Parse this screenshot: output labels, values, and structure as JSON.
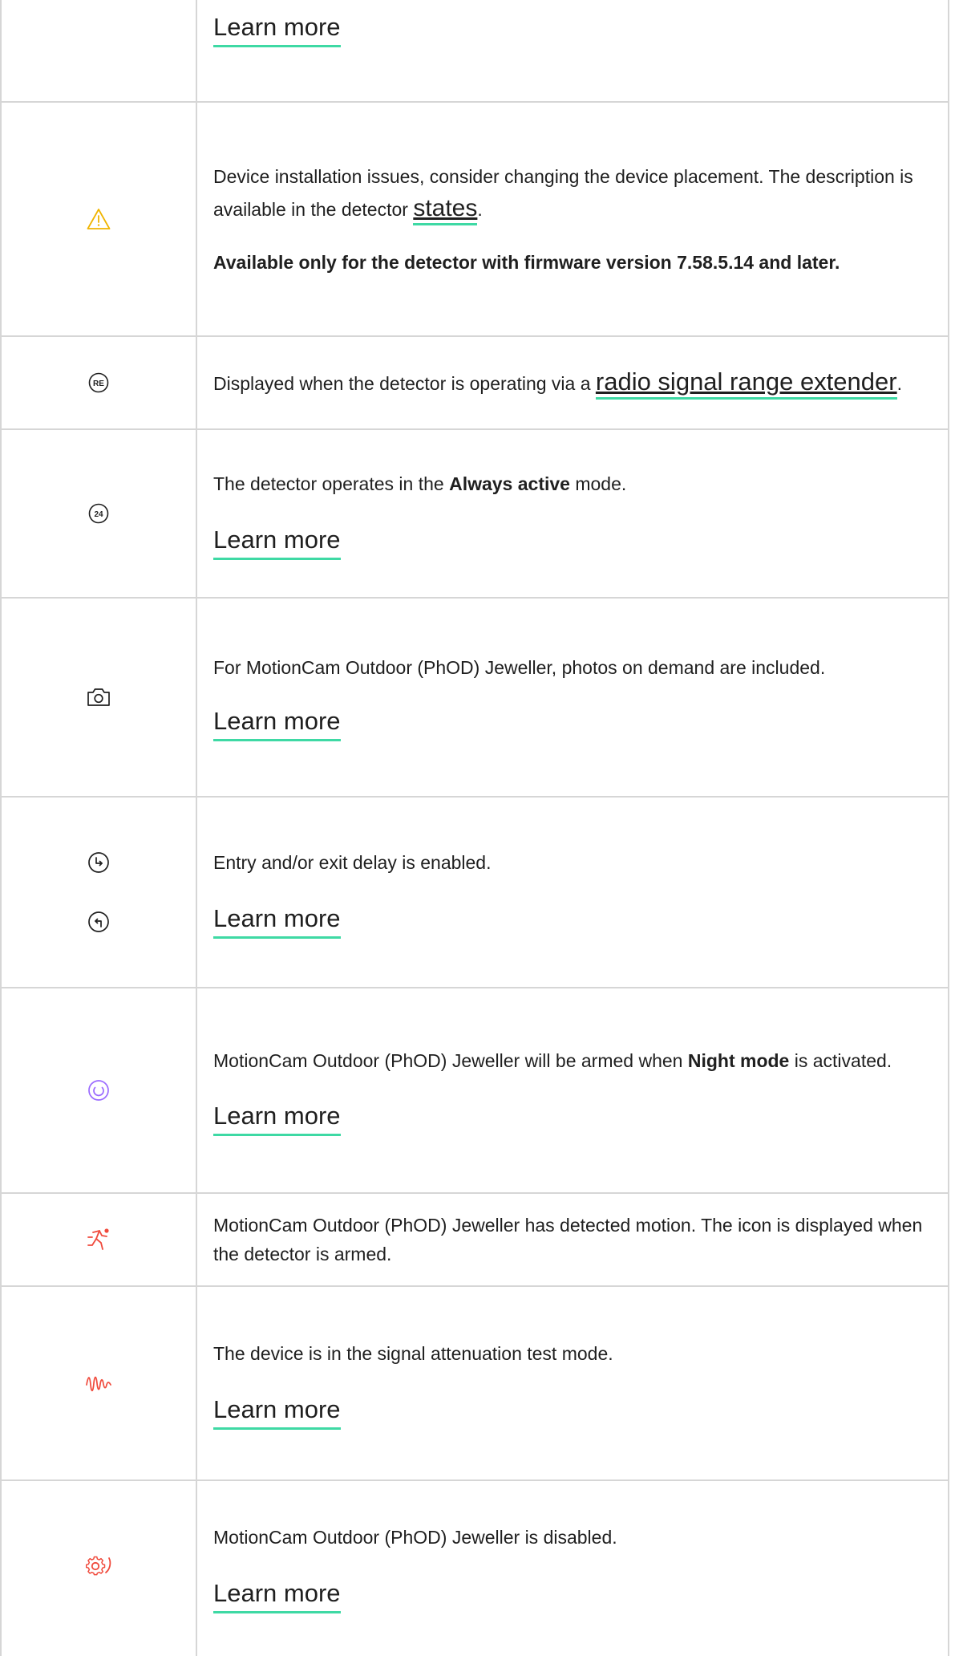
{
  "rows": [
    {
      "learn_more": "Learn more"
    },
    {
      "icon": "warning-triangle-icon",
      "text_before": "Device installation issues, consider changing the device placement. The description is available in the detector ",
      "link": "states",
      "text_after": ".",
      "note": "Available only for the detector with firmware version 7.58.5.14 and later."
    },
    {
      "icon": "range-extender-icon",
      "icon_text": "RE",
      "text_before": "Displayed when the detector is operating via a ",
      "link": "radio signal range extender",
      "text_after": "."
    },
    {
      "icon": "always-active-24-icon",
      "icon_text": "24",
      "text_before": "The detector operates in the ",
      "bold": "Always active",
      "text_after": " mode.",
      "learn_more": "Learn more"
    },
    {
      "icon": "camera-icon",
      "text": "For MotionCam Outdoor (PhOD) Jeweller, photos on demand are included.",
      "learn_more": "Learn more"
    },
    {
      "icon": "entry-exit-delay-icon",
      "text": "Entry and/or exit delay is enabled.",
      "learn_more": "Learn more"
    },
    {
      "icon": "night-mode-icon",
      "text_before": "MotionCam Outdoor (PhOD) Jeweller will be armed when ",
      "bold": "Night mode",
      "text_after": " is activated.",
      "learn_more": "Learn more"
    },
    {
      "icon": "motion-detected-icon",
      "text": "MotionCam Outdoor (PhOD) Jeweller has detected motion. The icon is displayed when the detector is armed."
    },
    {
      "icon": "signal-attenuation-icon",
      "text": "The device is in the signal attenuation test mode.",
      "learn_more": "Learn more"
    },
    {
      "icon": "device-disabled-icon",
      "text": "MotionCam Outdoor (PhOD) Jeweller is disabled.",
      "learn_more": "Learn more"
    }
  ],
  "colors": {
    "link_underline": "#3ed9a4",
    "warning_icon": "#f0b400",
    "night_mode_icon": "#9b6bff",
    "alert_icon": "#f04a3c",
    "border": "#d6d6d6"
  }
}
